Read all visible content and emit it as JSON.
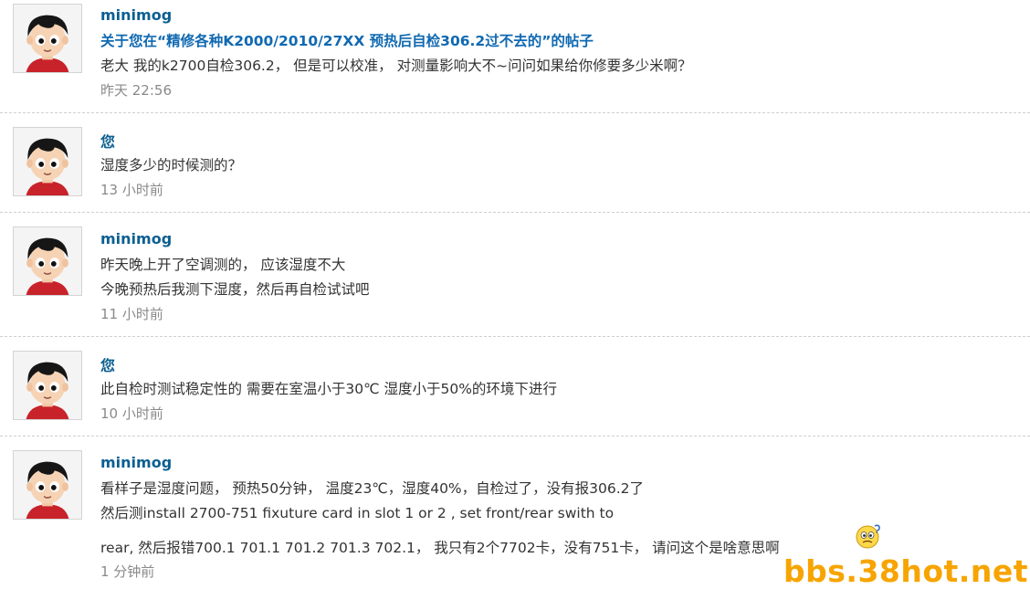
{
  "messages": [
    {
      "author": "minimog",
      "subject": "关于您在“精修各种K2000/2010/27XX 预热后自检306.2过不去的”的帖子",
      "lines": [
        "老大 我的k2700自检306.2， 但是可以校准， 对测量影响大不~问问如果给你修要多少米啊？"
      ],
      "time": "昨天 22:56"
    },
    {
      "author": "您",
      "lines": [
        "湿度多少的时候测的？"
      ],
      "time": "13 小时前"
    },
    {
      "author": "minimog",
      "lines": [
        "昨天晚上开了空调测的， 应该湿度不大",
        "今晚预热后我测下湿度，然后再自检试试吧"
      ],
      "time": "11 小时前"
    },
    {
      "author": "您",
      "lines": [
        "此自检时测试稳定性的 需要在室温小于30℃ 湿度小于50%的环境下进行"
      ],
      "time": "10 小时前"
    },
    {
      "author": "minimog",
      "lines": [
        "看样子是湿度问题， 预热50分钟， 温度23℃，湿度40%，自检过了，没有报306.2了",
        "然后测install 2700-751 fixuture card in slot 1 or 2 , set front/rear swith to",
        "rear, 然后报错700.1 701.1 701.2 701.3   702.1， 我只有2个7702卡，没有751卡， 请问这个是啥意思啊"
      ],
      "time": "1 分钟前",
      "emoticon": "confused-face-icon"
    }
  ],
  "watermark": "bbs.38hot.net",
  "colors": {
    "author": "#0c5f91",
    "subject": "#1069b1",
    "time": "#8a8a8a",
    "watermark": "#f7a400"
  }
}
